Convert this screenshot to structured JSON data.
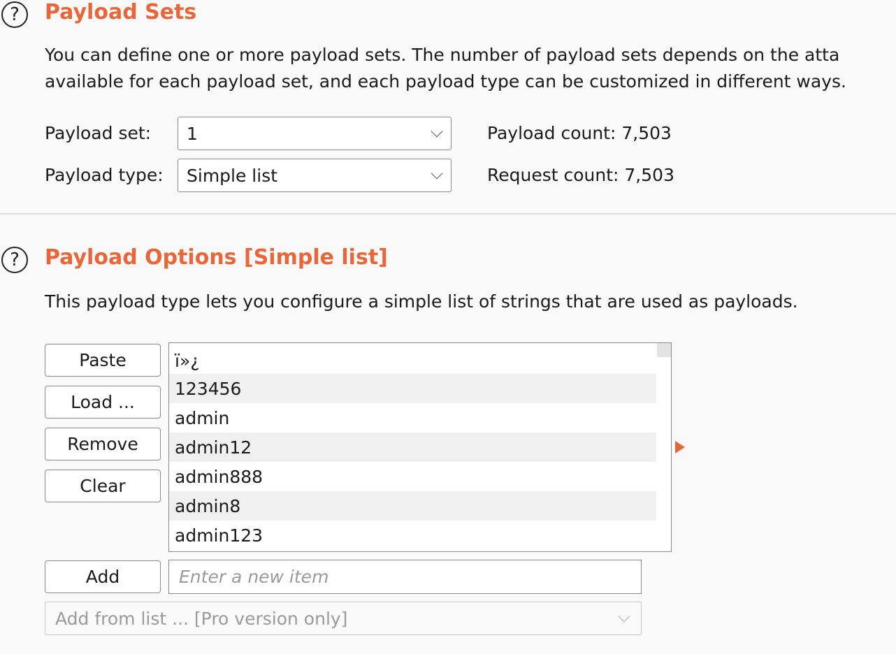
{
  "payload_sets": {
    "help_icon": "?",
    "title": "Payload Sets",
    "description_line1": "You can define one or more payload sets. The number of payload sets depends on the atta",
    "description_line2": "available for each payload set, and each payload type can be customized in different ways.",
    "payload_set_label": "Payload set:",
    "payload_set_value": "1",
    "payload_type_label": "Payload type:",
    "payload_type_value": "Simple list",
    "payload_count": "Payload count: 7,503",
    "request_count": "Request count: 7,503"
  },
  "payload_options": {
    "help_icon": "?",
    "title": "Payload Options [Simple list]",
    "description": "This payload type lets you configure a simple list of strings that are used as payloads.",
    "buttons": {
      "paste": "Paste",
      "load": "Load ...",
      "remove": "Remove",
      "clear": "Clear",
      "add": "Add"
    },
    "list_items": [
      "ï»¿",
      "123456",
      "admin",
      "admin12",
      "admin888",
      "admin8",
      "admin123"
    ],
    "new_item_placeholder": "Enter a new item",
    "add_from_list": "Add from list ... [Pro version only]"
  },
  "colors": {
    "accent": "#e8673a",
    "background": "#f9f9f9"
  }
}
